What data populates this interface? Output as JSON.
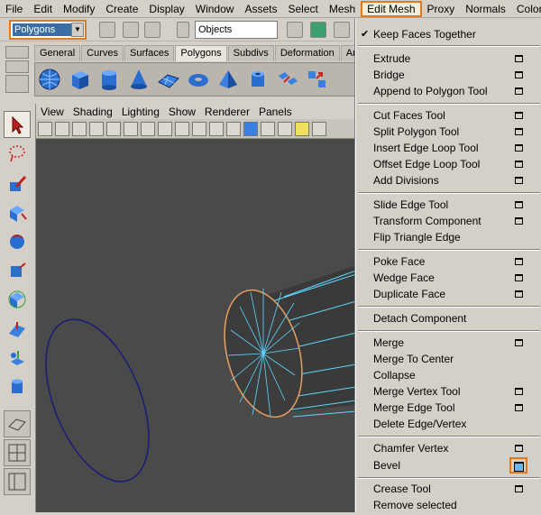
{
  "menubar": [
    "File",
    "Edit",
    "Modify",
    "Create",
    "Display",
    "Window",
    "Assets",
    "Select",
    "Mesh",
    "Edit Mesh",
    "Proxy",
    "Normals",
    "Color"
  ],
  "status": {
    "mode": "Polygons",
    "objects_field": "Objects"
  },
  "shelf": {
    "tabs": [
      "General",
      "Curves",
      "Surfaces",
      "Polygons",
      "Subdivs",
      "Deformation",
      "Animation"
    ],
    "selected_tab": "Polygons"
  },
  "panel_menu": [
    "View",
    "Shading",
    "Lighting",
    "Show",
    "Renderer",
    "Panels"
  ],
  "edit_mesh_menu": {
    "items": [
      {
        "label": "Keep Faces Together",
        "checked": true,
        "option": false
      },
      {
        "label": "Extrude",
        "option": true
      },
      {
        "label": "Bridge",
        "option": true
      },
      {
        "label": "Append to Polygon Tool",
        "option": true
      },
      {
        "label": "Cut Faces Tool",
        "option": true
      },
      {
        "label": "Split Polygon Tool",
        "option": true
      },
      {
        "label": "Insert Edge Loop Tool",
        "option": true
      },
      {
        "label": "Offset Edge Loop Tool",
        "option": true
      },
      {
        "label": "Add Divisions",
        "option": true
      },
      {
        "label": "Slide Edge Tool",
        "option": true
      },
      {
        "label": "Transform Component",
        "option": true
      },
      {
        "label": "Flip Triangle Edge",
        "option": false
      },
      {
        "label": "Poke Face",
        "option": true
      },
      {
        "label": "Wedge Face",
        "option": true
      },
      {
        "label": "Duplicate Face",
        "option": true
      },
      {
        "label": "Detach Component",
        "option": false
      },
      {
        "label": "Merge",
        "option": true
      },
      {
        "label": "Merge To Center",
        "option": false
      },
      {
        "label": "Collapse",
        "option": false
      },
      {
        "label": "Merge Vertex Tool",
        "option": true
      },
      {
        "label": "Merge Edge Tool",
        "option": true
      },
      {
        "label": "Delete Edge/Vertex",
        "option": false
      },
      {
        "label": "Chamfer Vertex",
        "option": true
      },
      {
        "label": "Bevel",
        "option": true,
        "highlighted": true
      },
      {
        "label": "Crease Tool",
        "option": true
      },
      {
        "label": "Remove selected",
        "option": false
      }
    ]
  },
  "colors": {
    "accent": "#e07a20",
    "viewport": "#4a4a4a",
    "wire": "#5fd8ff",
    "selection": "#3a6ea5"
  }
}
